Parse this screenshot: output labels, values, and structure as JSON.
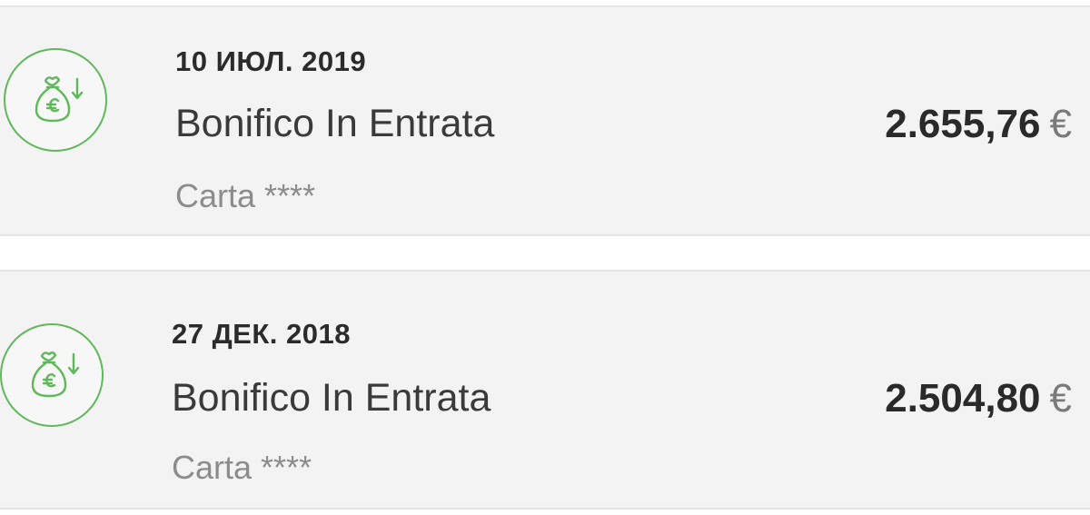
{
  "accent_color": "#5fb85a",
  "transactions": [
    {
      "icon": "money-bag-euro-incoming-icon",
      "date": "10 ИЮЛ. 2019",
      "description": "Bonifico In Entrata",
      "card": "Carta ****",
      "amount": "2.655,76",
      "currency": "€"
    },
    {
      "icon": "money-bag-euro-incoming-icon",
      "date": "27 ДЕК. 2018",
      "description": "Bonifico In Entrata",
      "card": "Carta ****",
      "amount": "2.504,80",
      "currency": "€"
    }
  ]
}
